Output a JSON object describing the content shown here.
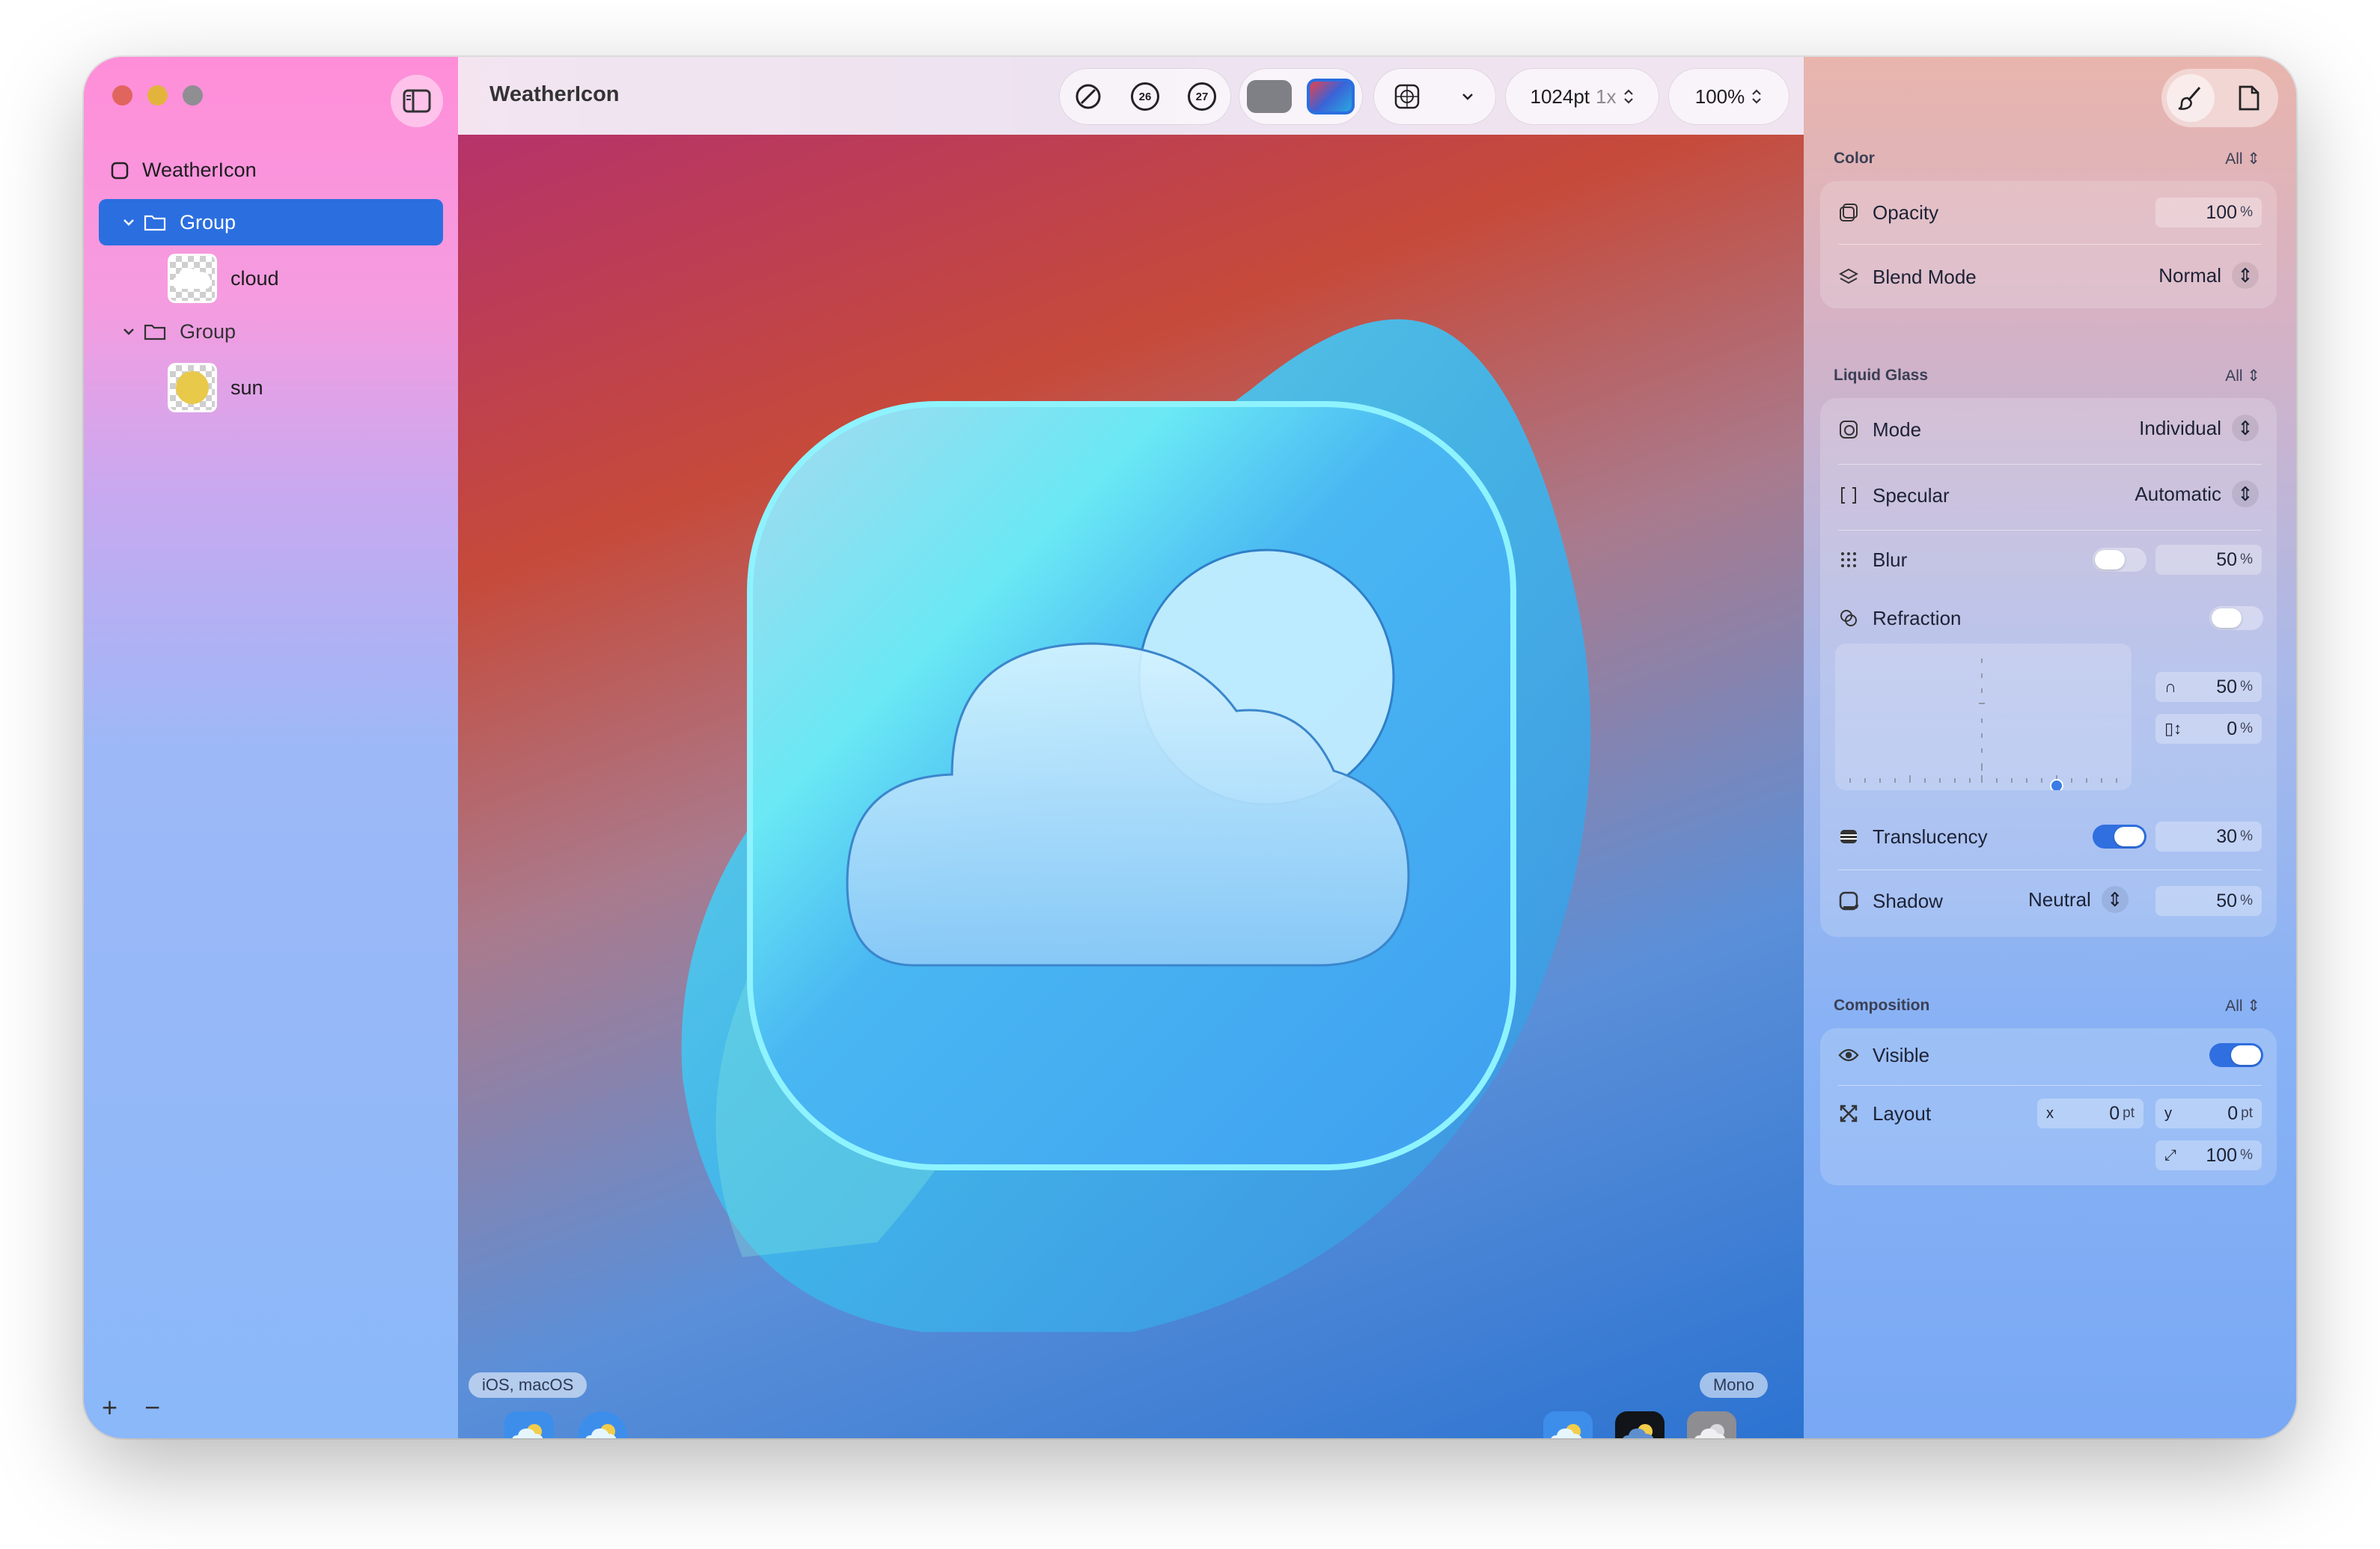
{
  "window": {
    "colors": {
      "accent": "#2b6ee0",
      "close": "#e0655e",
      "minimize": "#e3b43c",
      "zoom": "#8e8e93"
    }
  },
  "sidebar": {
    "root_label": "WeatherIcon",
    "groups": [
      {
        "label": "Group",
        "layer": "cloud"
      },
      {
        "label": "Group",
        "layer": "sun"
      }
    ],
    "add_label": "+",
    "remove_label": "−"
  },
  "toolbar": {
    "title": "WeatherIcon",
    "badge_26": "26",
    "badge_27": "27",
    "size": "1024pt",
    "scale": "1x",
    "zoom": "100%"
  },
  "canvas": {
    "platform_tag": "iOS, macOS",
    "mono_tag": "Mono"
  },
  "inspector": {
    "color": {
      "title": "Color",
      "filter": "All",
      "opacity_label": "Opacity",
      "opacity_value": "100",
      "blend_label": "Blend Mode",
      "blend_value": "Normal"
    },
    "liquid_glass": {
      "title": "Liquid Glass",
      "filter": "All",
      "mode_label": "Mode",
      "mode_value": "Individual",
      "specular_label": "Specular",
      "specular_value": "Automatic",
      "blur_label": "Blur",
      "blur_value": "50",
      "refraction_label": "Refraction",
      "refraction_amount": "50",
      "refraction_offset": "0",
      "translucency_label": "Translucency",
      "translucency_value": "30",
      "shadow_label": "Shadow",
      "shadow_mode": "Neutral",
      "shadow_value": "50"
    },
    "composition": {
      "title": "Composition",
      "filter": "All",
      "visible_label": "Visible",
      "layout_label": "Layout",
      "x_label": "x",
      "x_value": "0",
      "y_label": "y",
      "y_value": "0",
      "scale_value": "100"
    },
    "units": {
      "percent": "%",
      "pt": "pt"
    }
  }
}
